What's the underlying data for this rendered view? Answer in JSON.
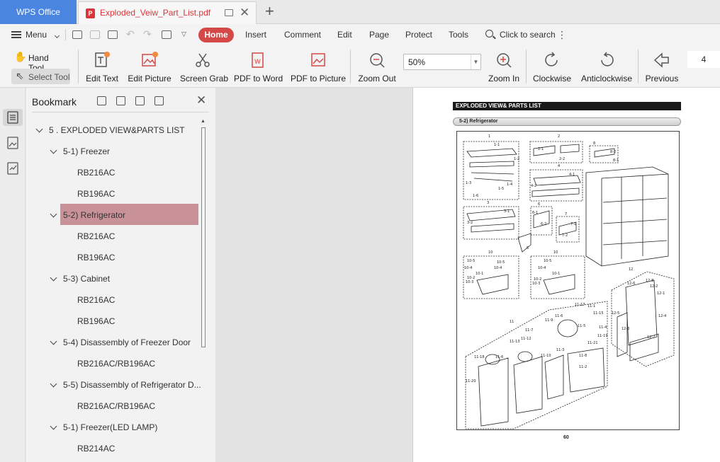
{
  "app": {
    "name": "WPS Office"
  },
  "tabs": [
    {
      "label": "Exploded_Veiw_Part_List.pdf",
      "active": true
    }
  ],
  "menu": {
    "menu_label": "Menu",
    "items": [
      "Home",
      "Insert",
      "Comment",
      "Edit",
      "Page",
      "Protect",
      "Tools"
    ],
    "active": "Home",
    "search_label": "Click to search"
  },
  "toolbar": {
    "hand_tool": "Hand Tool",
    "select_tool": "Select Tool",
    "tools": [
      "Edit Text",
      "Edit Picture",
      "Screen Grab",
      "PDF to Word",
      "PDF to Picture",
      "Zoom Out",
      "Zoom In",
      "Clockwise",
      "Anticlockwise",
      "Previous"
    ],
    "zoom_value": "50%",
    "page_number": "4"
  },
  "bookmark": {
    "title": "Bookmark",
    "items": [
      {
        "label": "5 . EXPLODED VIEW&PARTS LIST",
        "level": 0,
        "expanded": true
      },
      {
        "label": "5-1) Freezer",
        "level": 1,
        "expanded": true
      },
      {
        "label": "RB216AC",
        "level": 2
      },
      {
        "label": "RB196AC",
        "level": 2
      },
      {
        "label": "5-2) Refrigerator",
        "level": 1,
        "expanded": true,
        "selected": true
      },
      {
        "label": "RB216AC",
        "level": 2
      },
      {
        "label": "RB196AC",
        "level": 2
      },
      {
        "label": "5-3) Cabinet",
        "level": 1,
        "expanded": true
      },
      {
        "label": "RB216AC",
        "level": 2
      },
      {
        "label": "RB196AC",
        "level": 2
      },
      {
        "label": "5-4) Disassembly of Freezer Door",
        "level": 1,
        "expanded": true
      },
      {
        "label": "RB216AC/RB196AC",
        "level": 2
      },
      {
        "label": "5-5) Disassembly of Refrigerator D...",
        "level": 1,
        "expanded": true
      },
      {
        "label": "RB216AC/RB196AC",
        "level": 2
      },
      {
        "label": "5-1) Freezer(LED LAMP)",
        "level": 1,
        "expanded": true
      },
      {
        "label": "RB214AC",
        "level": 2
      }
    ]
  },
  "document": {
    "header": "EXPLODED VIEW& PARTS LIST",
    "subheader": "5-2) Refrigerator",
    "page_footer": "60",
    "callouts": [
      "1",
      "1-1",
      "1-2",
      "1-3",
      "1-4",
      "1-5",
      "1-6",
      "2",
      "2-1",
      "2-2",
      "3",
      "3-1",
      "3-2",
      "4",
      "4-1",
      "4-2",
      "5",
      "6",
      "6-1",
      "6-2",
      "7",
      "7-1",
      "7-2",
      "8",
      "8-1",
      "8-2",
      "10",
      "10-1",
      "10-2",
      "10-3",
      "10-4",
      "10-5",
      "11",
      "11-1",
      "11-2",
      "11-3",
      "11-4",
      "11-5",
      "11-6",
      "11-7",
      "11-8",
      "11-9",
      "11-10",
      "11-11",
      "11-12",
      "11-13",
      "11-15",
      "11-17",
      "11-18",
      "11-19",
      "11-20",
      "11-21",
      "12",
      "12-1",
      "12-2",
      "12-3",
      "12-4",
      "12-5",
      "12-6",
      "12-7",
      "12-8"
    ]
  },
  "colors": {
    "accent": "#d54848",
    "wps_tab": "#4a86e0",
    "selected_bookmark": "#c99298"
  }
}
